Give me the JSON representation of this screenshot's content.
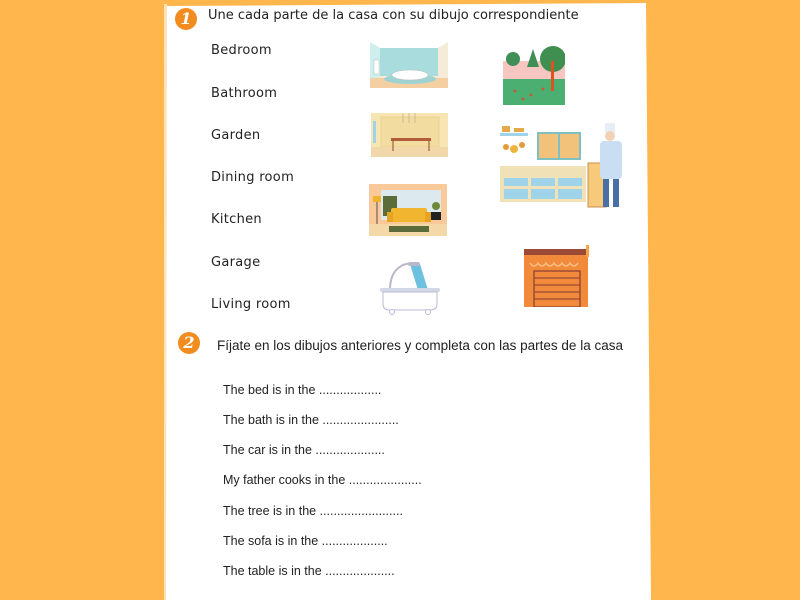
{
  "colors": {
    "background": "#ffb74d",
    "accent": "#f28c1e",
    "paper": "#ffffff"
  },
  "exercise1": {
    "number": "1",
    "title": "Une cada parte de la casa con su dibujo correspondiente",
    "words": [
      "Bedroom",
      "Bathroom",
      "Garden",
      "Dining room",
      "Kitchen",
      "Garage",
      "Living room"
    ],
    "pictures": [
      "bedroom-picture",
      "garden-picture",
      "dining-room-picture",
      "kitchen-picture",
      "living-room-picture",
      "garage-picture",
      "bathtub-picture"
    ]
  },
  "exercise2": {
    "number": "2",
    "title": "Fíjate en los dibujos anteriores y completa con las partes de la casa",
    "sentences": [
      "The bed is in the ..................",
      "The bath is in the ......................",
      "The car is in the ....................",
      "My father cooks in the .....................",
      "The tree is in the ........................",
      "The sofa is in the ...................",
      "The table is in the ...................."
    ]
  }
}
